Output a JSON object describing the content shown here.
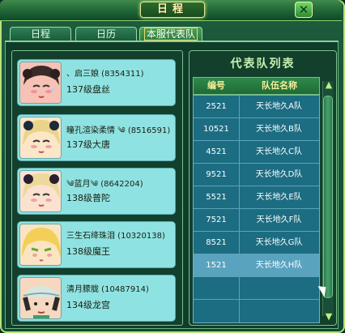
{
  "window": {
    "title": "日程"
  },
  "tabs": [
    {
      "label": "日程"
    },
    {
      "label": "日历"
    },
    {
      "label": "本服代表队"
    }
  ],
  "members": [
    {
      "name": "、启三娘 (8354311)",
      "level": "137级盘丝",
      "avatar_icon": "character-avatar-pink"
    },
    {
      "name": "瞳孔渲染柔情 ༄ (8516591)",
      "level": "137级大唐",
      "avatar_icon": "character-avatar-blonde"
    },
    {
      "name": "༄蓝月༄ (8642204)",
      "level": "138级普陀",
      "avatar_icon": "character-avatar-blonde"
    },
    {
      "name": "三生石绛珠泪 (10320138)",
      "level": "138级魔王",
      "avatar_icon": "character-avatar-fox"
    },
    {
      "name": "清月朦胧 (10487914)",
      "level": "134级龙宫",
      "avatar_icon": "character-avatar-hat"
    }
  ],
  "team_list": {
    "title": "代表队列表",
    "columns": [
      "编号",
      "队伍名称"
    ],
    "rows": [
      {
        "id": "2521",
        "name": "天长地久A队"
      },
      {
        "id": "10521",
        "name": "天长地久B队"
      },
      {
        "id": "4521",
        "name": "天长地久C队"
      },
      {
        "id": "9521",
        "name": "天长地久D队"
      },
      {
        "id": "5521",
        "name": "天长地久E队"
      },
      {
        "id": "7521",
        "name": "天长地久F队"
      },
      {
        "id": "8521",
        "name": "天长地久G队"
      },
      {
        "id": "1521",
        "name": "天长地久H队"
      },
      {
        "id": "",
        "name": ""
      },
      {
        "id": "",
        "name": ""
      }
    ],
    "selected_index": 7
  },
  "colors": {
    "frame": "#1d5c3c",
    "member_card": "#8fe2e2",
    "table_body": "#1c6d82",
    "selected_row": "#5aa3bf",
    "header_text": "#f7ef9a"
  }
}
